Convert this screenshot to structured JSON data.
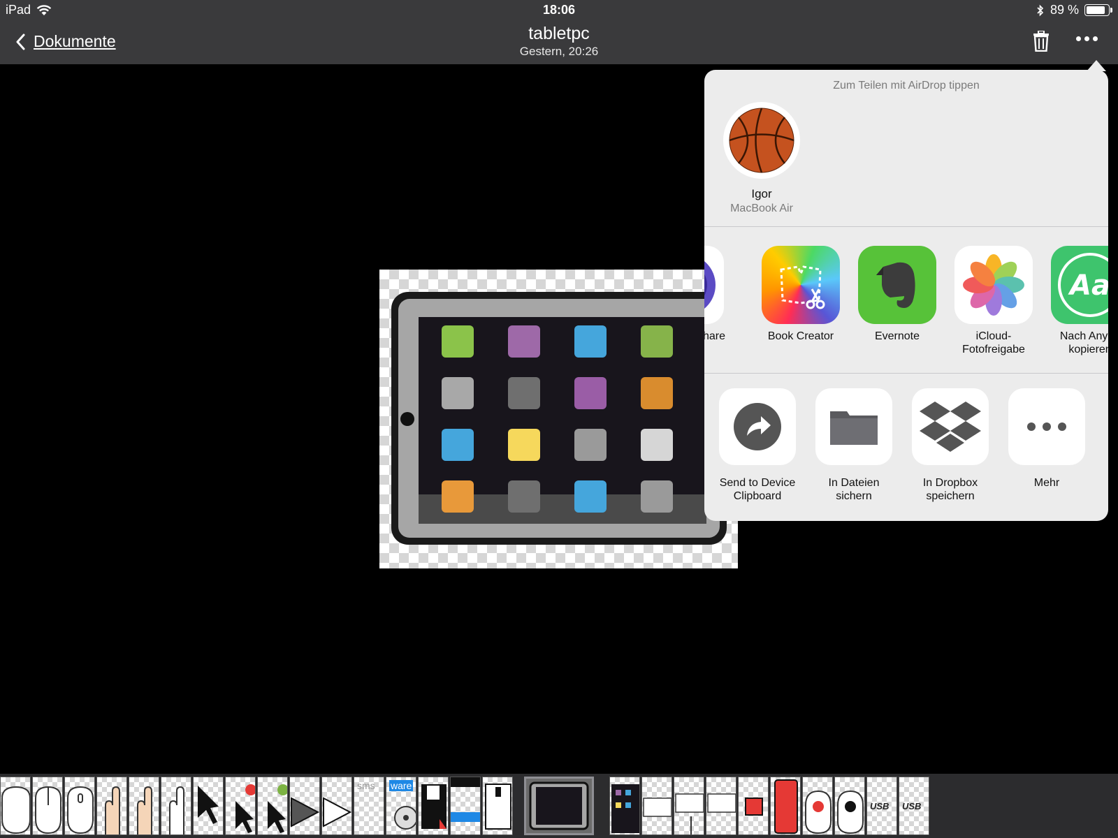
{
  "status_bar": {
    "device": "iPad",
    "time": "18:06",
    "battery_text": "89 %",
    "battery_level": 0.89
  },
  "nav": {
    "back_label": "Dokumente",
    "title": "tabletpc",
    "subtitle": "Gestern, 20:26",
    "trash_icon": "trash-icon",
    "more_icon": "ellipsis-icon"
  },
  "share_sheet": {
    "airdrop_hint": "Zum Teilen mit AirDrop tippen",
    "airdrop_person": {
      "name": "Igor",
      "device": "MacBook Air",
      "avatar_icon": "basketball-icon"
    },
    "apps": [
      {
        "label": "hare",
        "icon": "share-app-icon"
      },
      {
        "label": "Book Creator",
        "icon": "book-creator-icon"
      },
      {
        "label": "Evernote",
        "icon": "evernote-icon"
      },
      {
        "label": "iCloud-\nFotofreigabe",
        "icon": "photos-icon"
      },
      {
        "label": "Nach AnyFc\nkopieren",
        "icon": "anyfont-icon"
      }
    ],
    "actions": [
      {
        "label": "Send to Device\nClipboard",
        "icon": "share-arrow-icon"
      },
      {
        "label": "In Dateien\nsichern",
        "icon": "folder-icon"
      },
      {
        "label": "In Dropbox\nspeichern",
        "icon": "dropbox-icon"
      },
      {
        "label": "Mehr",
        "icon": "more-dots-icon"
      }
    ]
  },
  "thumbnail_strip": {
    "texts": {
      "sms": "sms",
      "ware": "ware",
      "usb": "USB"
    }
  },
  "colors": {
    "bar_background": "#3a3a3c",
    "sheet_background": "#ececec",
    "evernote_green": "#57c239",
    "anyfont_green": "#3ec46d"
  }
}
